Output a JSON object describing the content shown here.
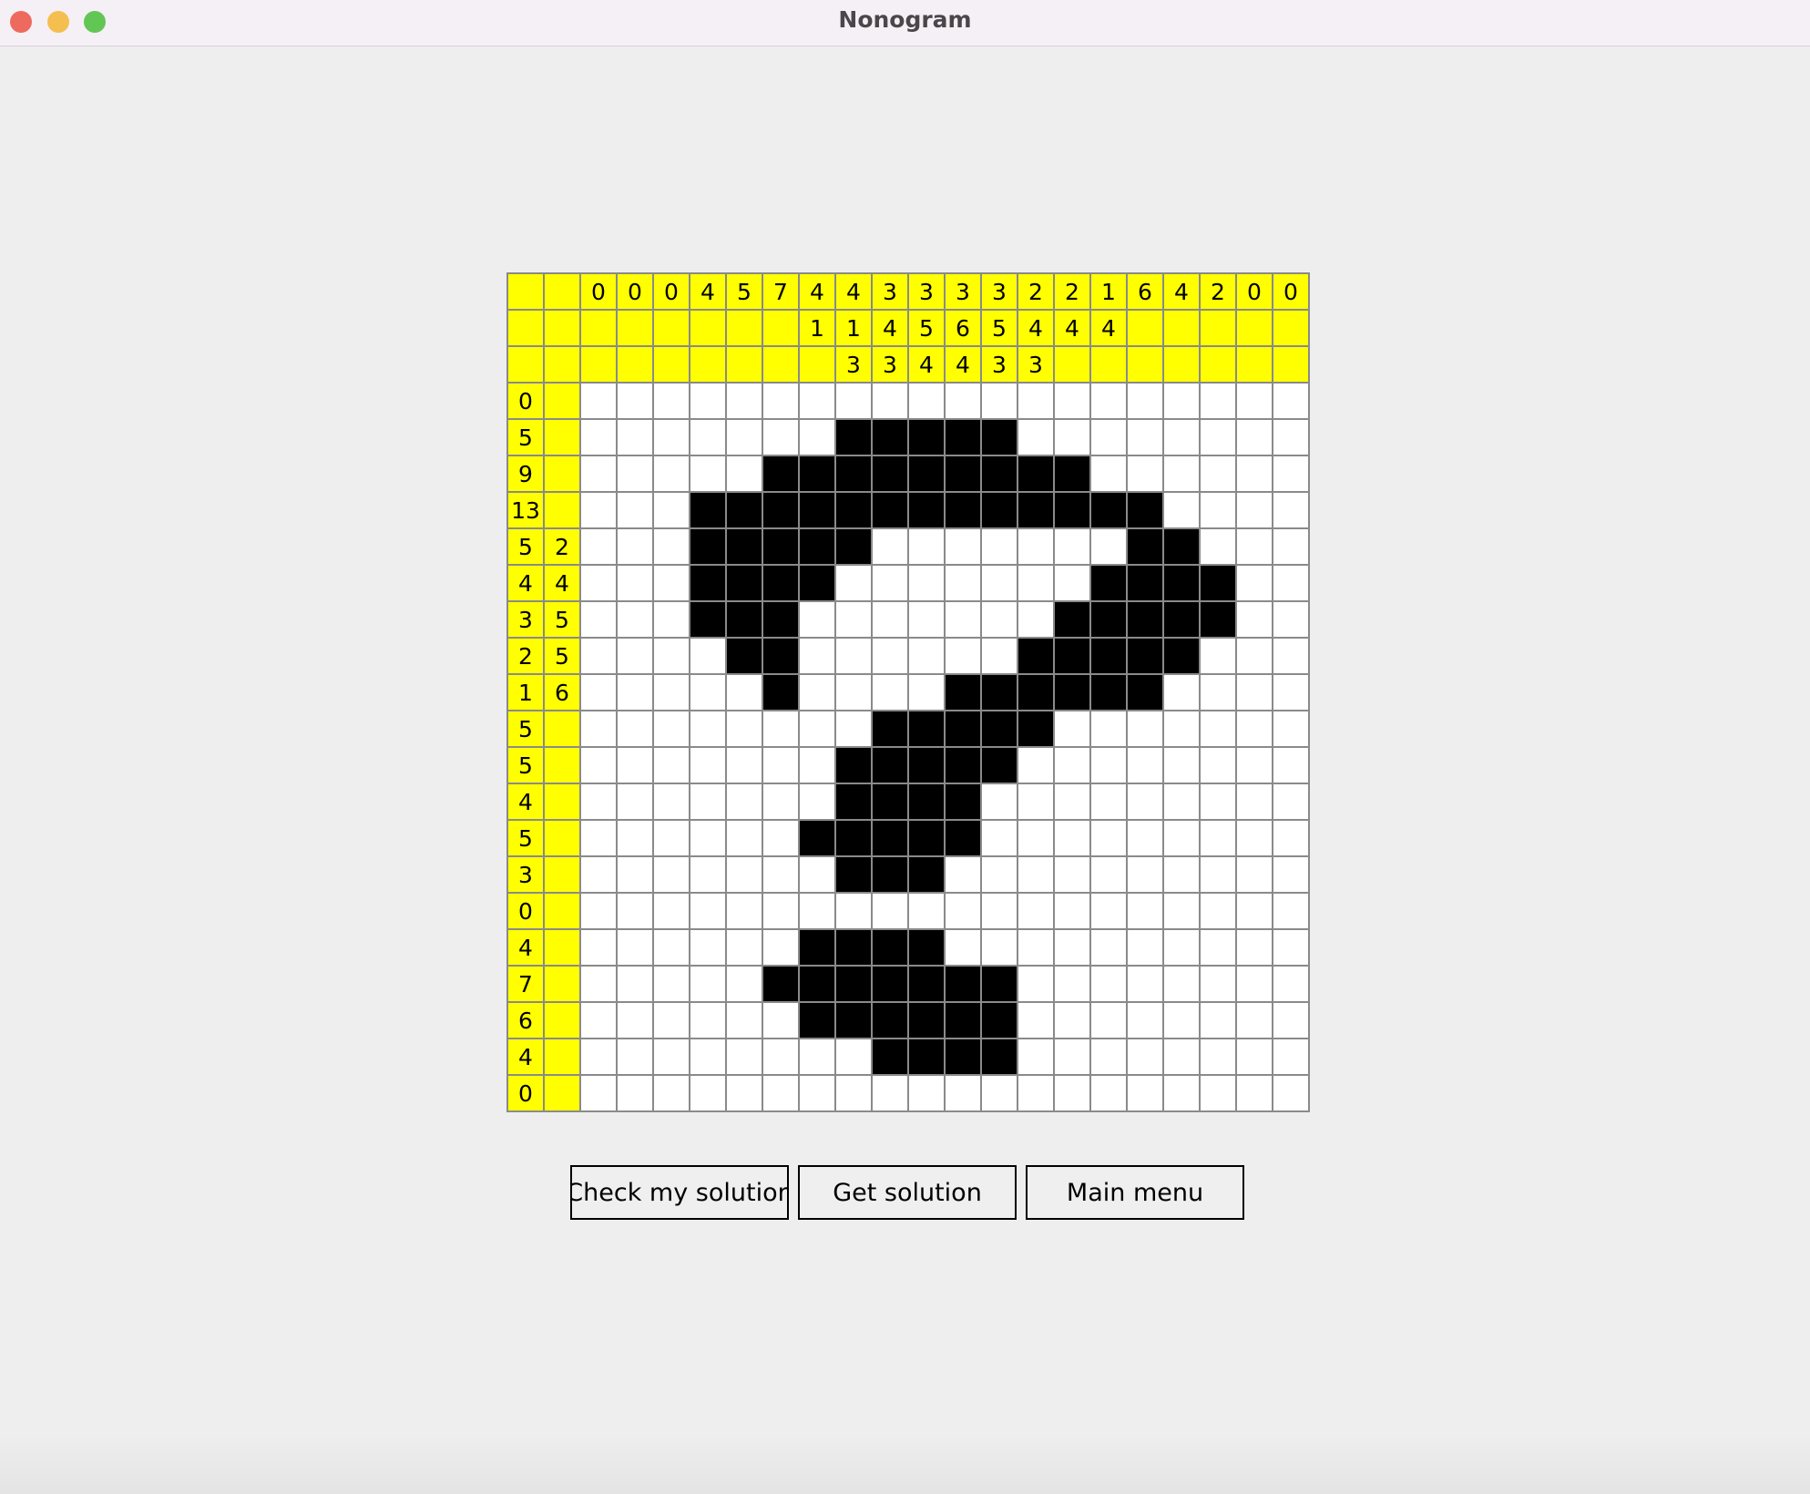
{
  "window": {
    "title": "Nonogram"
  },
  "puzzle": {
    "columns": 20,
    "rows": 20,
    "column_clues": [
      [
        "0"
      ],
      [
        "0"
      ],
      [
        "0"
      ],
      [
        "4"
      ],
      [
        "5"
      ],
      [
        "7"
      ],
      [
        "4",
        "1"
      ],
      [
        "4",
        "1",
        "3"
      ],
      [
        "3",
        "4",
        "3"
      ],
      [
        "3",
        "5",
        "4"
      ],
      [
        "3",
        "6",
        "4"
      ],
      [
        "3",
        "5",
        "3"
      ],
      [
        "2",
        "4",
        "3"
      ],
      [
        "2",
        "4"
      ],
      [
        "1",
        "4"
      ],
      [
        "6"
      ],
      [
        "4"
      ],
      [
        "2"
      ],
      [
        "0"
      ],
      [
        "0"
      ]
    ],
    "row_clues": [
      [
        "0"
      ],
      [
        "5"
      ],
      [
        "9"
      ],
      [
        "13"
      ],
      [
        "5",
        "2"
      ],
      [
        "4",
        "4"
      ],
      [
        "3",
        "5"
      ],
      [
        "2",
        "5"
      ],
      [
        "1",
        "6"
      ],
      [
        "5"
      ],
      [
        "5"
      ],
      [
        "4"
      ],
      [
        "5"
      ],
      [
        "3"
      ],
      [
        "0"
      ],
      [
        "4"
      ],
      [
        "7"
      ],
      [
        "6"
      ],
      [
        "4"
      ],
      [
        "0"
      ]
    ],
    "grid": [
      "....................",
      ".......#####........",
      ".....#########......",
      "...#############....",
      "...#####.......##...",
      "...####.......####..",
      "...###.......#####..",
      "....##......#####...",
      ".....#....######....",
      "........#####.......",
      ".......#####........",
      ".......####.........",
      "......#####.........",
      ".......###..........",
      "....................",
      "......####..........",
      ".....#######........",
      "......######........",
      "........####........",
      "...................."
    ]
  },
  "buttons": {
    "check": "Check my solution",
    "get_solution": "Get solution",
    "main_menu": "Main menu"
  },
  "colors": {
    "clue_background": "#ffff00",
    "filled_cell": "#000000",
    "empty_cell": "#ffffff",
    "grid_line": "#8a8a8a"
  }
}
